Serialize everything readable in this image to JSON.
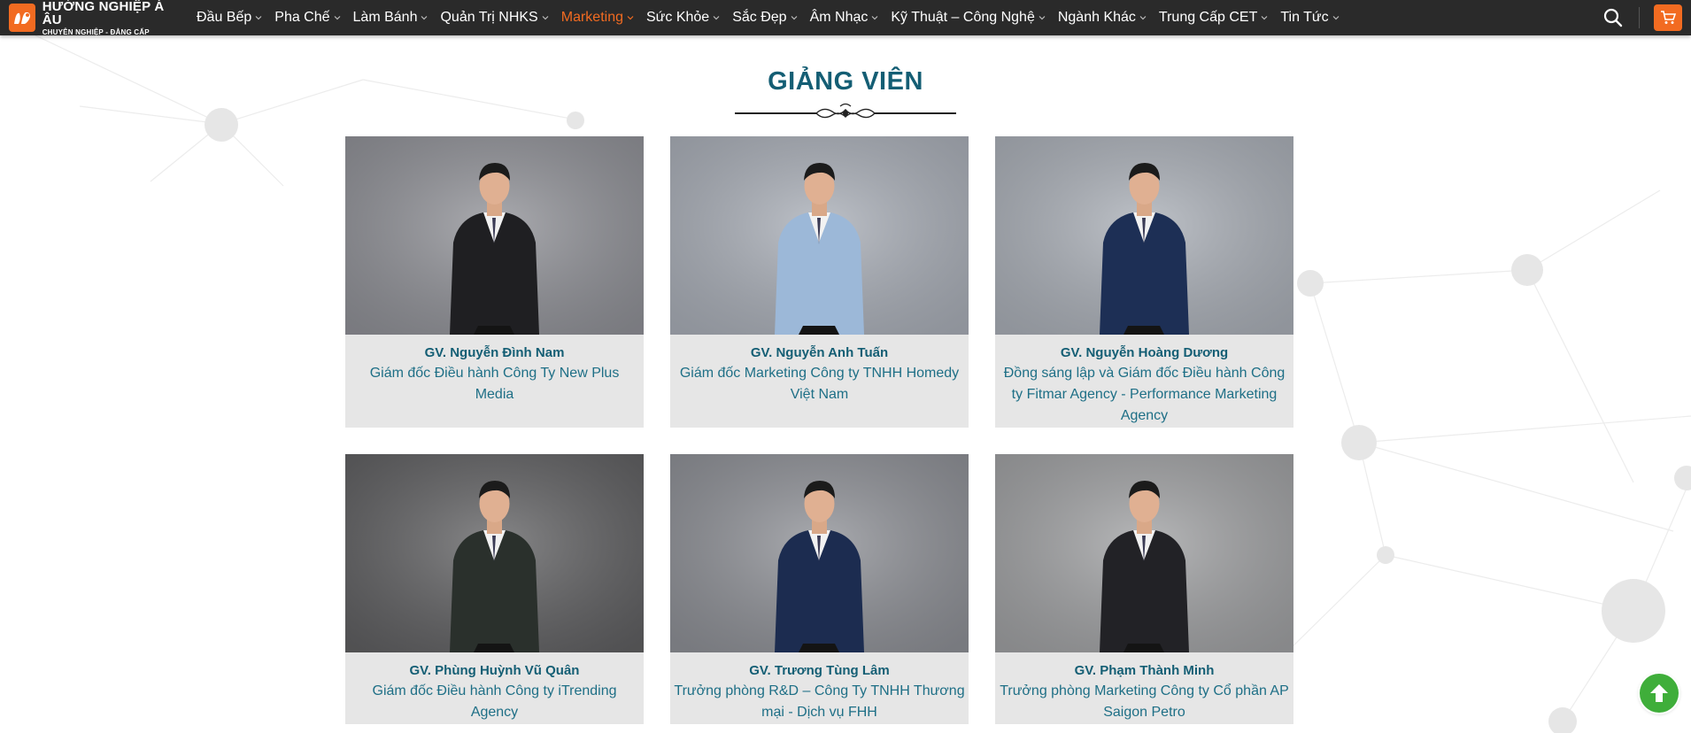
{
  "brand": {
    "title": "HƯỚNG NGHIỆP Á ÂU",
    "tagline": "CHUYÊN NGHIỆP - ĐẲNG CẤP",
    "accent": "#f26b21",
    "logo_icon": "chef-hat-logo-icon"
  },
  "nav": {
    "items": [
      {
        "label": "Đầu Bếp"
      },
      {
        "label": "Pha Chế"
      },
      {
        "label": "Làm Bánh"
      },
      {
        "label": "Quản Trị NHKS"
      },
      {
        "label": "Marketing",
        "active": true
      },
      {
        "label": "Sức Khỏe"
      },
      {
        "label": "Sắc Đẹp"
      },
      {
        "label": "Âm Nhạc"
      },
      {
        "label": "Kỹ Thuật – Công Nghệ"
      },
      {
        "label": "Ngành Khác"
      },
      {
        "label": "Trung Cấp CET"
      },
      {
        "label": "Tin Tức"
      }
    ],
    "search_icon": "search-icon",
    "cart_icon": "cart-icon"
  },
  "section": {
    "title": "GIẢNG VIÊN",
    "title_color": "#145e74"
  },
  "instructors": [
    {
      "name": "GV. Nguyễn Đình Nam",
      "role": "Giám đốc Điều hành Công Ty New Plus Media",
      "suit": "#1f1f22",
      "bg": "#8f9096"
    },
    {
      "name": "GV. Nguyễn Anh Tuấn",
      "role": "Giám đốc Marketing Công ty TNHH Homedy Việt Nam",
      "suit": "#9cb8d8",
      "bg": "#a8adb6"
    },
    {
      "name": "GV. Nguyễn Hoàng Dương",
      "role": "Đồng sáng lập và Giám đốc Điều hành Công ty Fitmar Agency - Performance Marketing Agency",
      "suit": "#1d2f55",
      "bg": "#a9aeb6"
    },
    {
      "name": "GV. Phùng Huỳnh Vũ Quân",
      "role": "Giám đốc Điều hành Công ty iTrending Agency",
      "suit": "#2a302c",
      "bg": "#5f5f61"
    },
    {
      "name": "GV. Trương Tùng Lâm",
      "role": "Trưởng phòng R&D – Công Ty TNHH Thương mại - Dịch vụ FHH",
      "suit": "#1c2c50",
      "bg": "#8d8f95"
    },
    {
      "name": "GV. Phạm Thành Minh",
      "role": "Trưởng phòng Marketing Công ty Cổ phần AP Saigon Petro",
      "suit": "#222226",
      "bg": "#9fa0a2"
    }
  ],
  "scroll_top_icon": "arrow-up-icon"
}
